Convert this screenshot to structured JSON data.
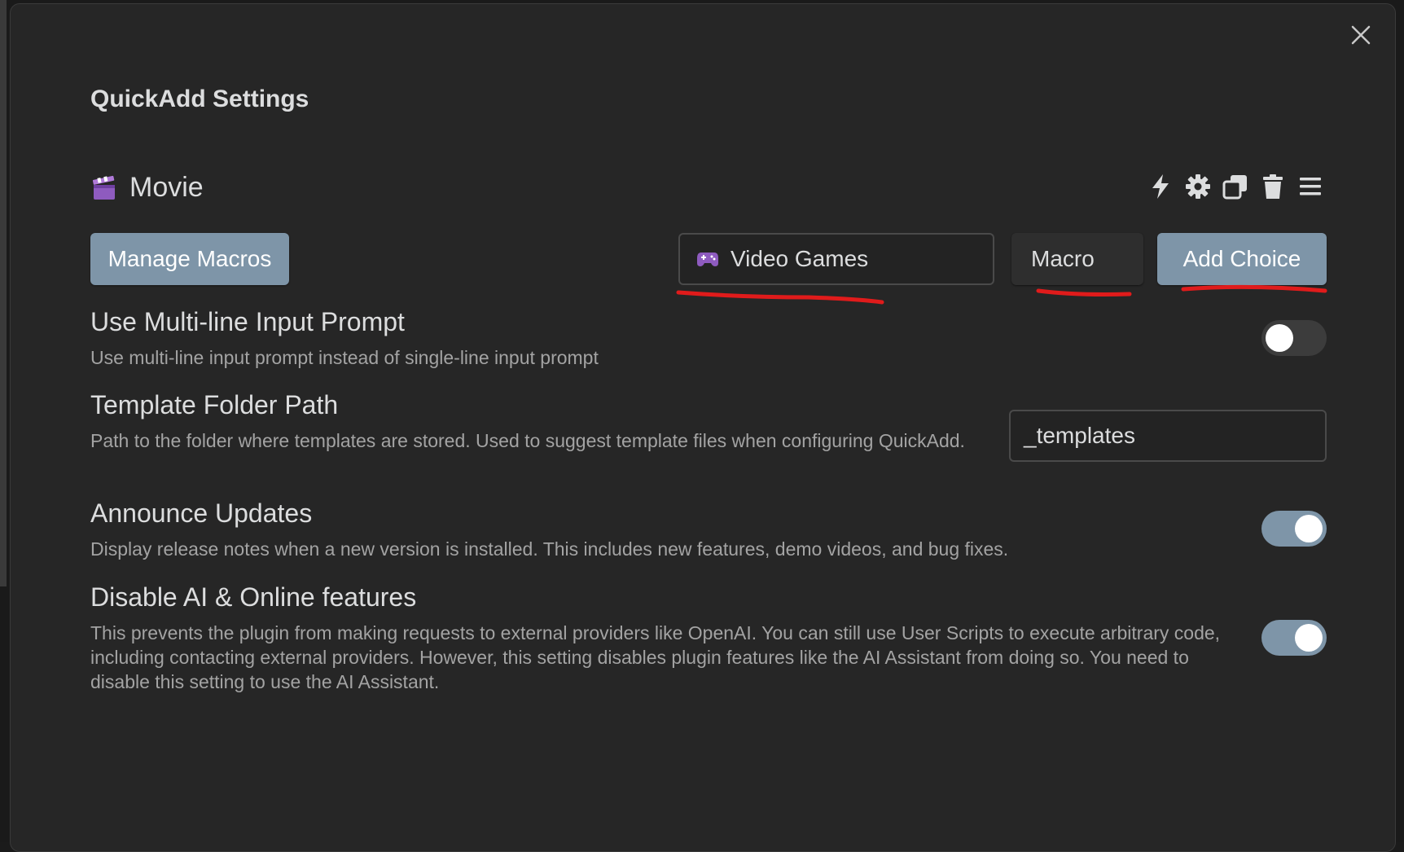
{
  "modal": {
    "title": "QuickAdd Settings"
  },
  "choice": {
    "emoji": "clapper-board-icon",
    "name": "Movie",
    "tools": [
      "lightning-icon",
      "gear-icon",
      "duplicate-icon",
      "trash-icon",
      "drag-menu-icon"
    ]
  },
  "actions": {
    "manage_macros": "Manage Macros",
    "name_input_value": "Video Games",
    "name_input_icon": "gamepad-icon",
    "type_select_value": "Macro",
    "add_choice": "Add Choice"
  },
  "settings": [
    {
      "name": "Use Multi-line Input Prompt",
      "desc": "Use multi-line input prompt instead of single-line input prompt",
      "control": "toggle",
      "enabled": false
    },
    {
      "name": "Template Folder Path",
      "desc": "Path to the folder where templates are stored. Used to suggest template files when configuring QuickAdd.",
      "control": "text",
      "value": "_templates"
    },
    {
      "name": "Announce Updates",
      "desc": "Display release notes when a new version is installed. This includes new features, demo videos, and bug fixes.",
      "control": "toggle",
      "enabled": true
    },
    {
      "name": "Disable AI & Online features",
      "desc": "This prevents the plugin from making requests to external providers like OpenAI. You can still use User Scripts to execute arbitrary code, including contacting external providers. However, this setting disables plugin features like the AI Assistant from doing so. You need to disable this setting to use the AI Assistant.",
      "control": "toggle",
      "enabled": true
    }
  ],
  "colors": {
    "accent": "#7e95a8",
    "annotation": "#e01b1b",
    "background": "#262626"
  }
}
